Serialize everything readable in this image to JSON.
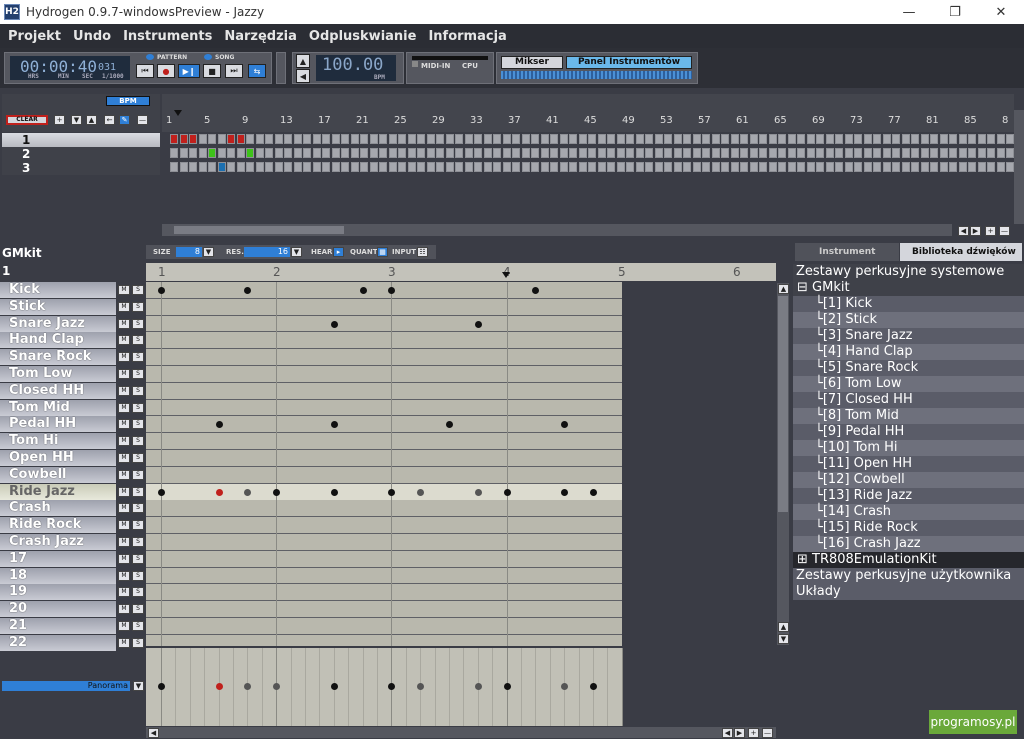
{
  "window": {
    "title": "Hydrogen 0.9.7-windowsPreview - Jazzy",
    "icon": "H2"
  },
  "menu": [
    "Projekt",
    "Undo",
    "Instruments",
    "Narzędzia",
    "Odpluskwianie",
    "Informacja"
  ],
  "transport": {
    "time": "00:00:40",
    "time_ms": "031",
    "hrs": "HRS",
    "min": "MIN",
    "sec": "SEC",
    "ms": "1/1000",
    "pattern_label": "PATTERN",
    "song_label": "SONG"
  },
  "tempo": {
    "bpm": "100.00",
    "bpm_label": "BPM"
  },
  "midi": {
    "midi_in": "MIDI-IN",
    "cpu": "CPU"
  },
  "panels": {
    "mixer": "Mikser",
    "instruments": "Panel Instrumentów"
  },
  "song_editor": {
    "bpm_btn": "BPM",
    "clear": "CLEAR",
    "patterns": [
      "1",
      "2",
      "3"
    ],
    "ruler": [
      "1",
      "5",
      "9",
      "13",
      "17",
      "21",
      "25",
      "29",
      "33",
      "37",
      "41",
      "45",
      "49",
      "53",
      "57",
      "61",
      "65",
      "69",
      "73",
      "77",
      "81",
      "85",
      "8"
    ]
  },
  "pattern_editor": {
    "kit": "GMkit",
    "pattern": "1",
    "size_label": "SIZE",
    "size": "8",
    "res_label": "RES.",
    "res": "16",
    "hear": "HEAR",
    "quant": "QUANT",
    "input": "INPUT",
    "beats": [
      "1",
      "2",
      "3",
      "4",
      "5",
      "6"
    ],
    "panorama": "Panorama",
    "instruments": [
      "Kick",
      "Stick",
      "Snare Jazz",
      "Hand Clap",
      "Snare Rock",
      "Tom Low",
      "Closed HH",
      "Tom Mid",
      "Pedal HH",
      "Tom Hi",
      "Open HH",
      "Cowbell",
      "Ride Jazz",
      "Crash",
      "Ride Rock",
      "Crash Jazz",
      "17",
      "18",
      "19",
      "20",
      "21",
      "22"
    ],
    "selected_row": 12
  },
  "sidebar": {
    "tab_instrument": "Instrument",
    "tab_library": "Biblioteka dźwięków",
    "system_kits": "Zestawy perkusyjne systemowe",
    "gmkit": "GMkit",
    "items": [
      "[1] Kick",
      "[2] Stick",
      "[3] Snare Jazz",
      "[4] Hand Clap",
      "[5] Snare Rock",
      "[6] Tom Low",
      "[7] Closed HH",
      "[8] Tom Mid",
      "[9] Pedal HH",
      "[10] Tom Hi",
      "[11] Open HH",
      "[12] Cowbell",
      "[13] Ride Jazz",
      "[14] Crash",
      "[15] Ride Rock",
      "[16] Crash Jazz"
    ],
    "tr808": "TR808EmulationKit",
    "user_kits": "Zestawy perkusyjne użytkownika",
    "layouts": "Układy"
  },
  "watermark": "programosy.pl",
  "colors": {
    "accent": "#2f7fd6",
    "red_note": "#c0201c",
    "green_cell": "#3ec21a",
    "blue_cell": "#1b6fb0"
  }
}
